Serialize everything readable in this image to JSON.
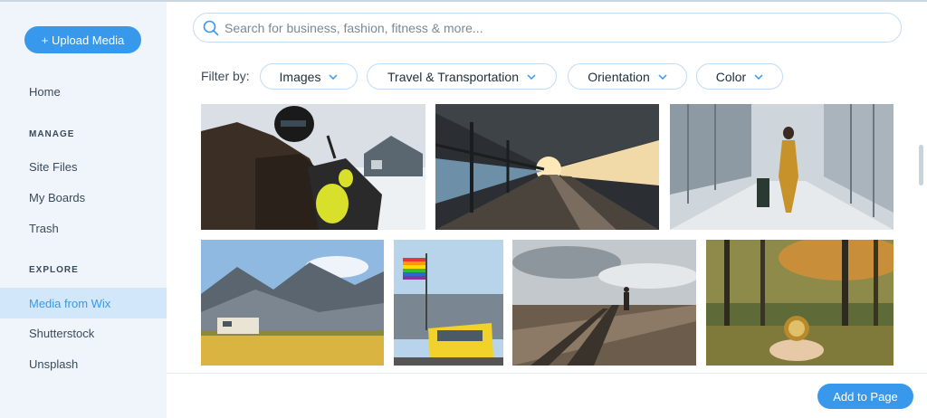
{
  "sidebar": {
    "upload_label": "+ Upload Media",
    "home": "Home",
    "manage_heading": "MANAGE",
    "manage_items": [
      "Site Files",
      "My Boards",
      "Trash"
    ],
    "explore_heading": "EXPLORE",
    "explore_items": [
      "Media from Wix",
      "Shutterstock",
      "Unsplash"
    ],
    "active_item": "Media from Wix"
  },
  "search": {
    "placeholder": "Search for business, fashion, fitness & more..."
  },
  "filters": {
    "label": "Filter by:",
    "chips": [
      "Images",
      "Travel & Transportation",
      "Orientation",
      "Color"
    ]
  },
  "gallery": {
    "photos": [
      "motorcycle-rider",
      "train-platform-sunset",
      "airport-walkway-traveler",
      "mountain-camper-van",
      "street-tram-rainbow-flag",
      "railroad-tracks-walker",
      "forest-compass-hand"
    ]
  },
  "footer": {
    "add_label": "Add to Page"
  },
  "colors": {
    "accent": "#3899ec",
    "sidebar_bg": "#eff5fb",
    "active_bg": "#d3e7fa"
  }
}
